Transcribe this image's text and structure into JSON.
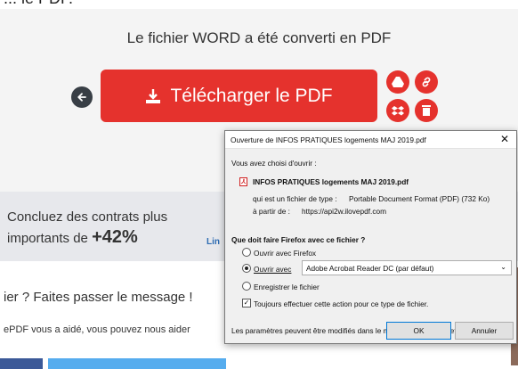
{
  "top_fragment": "... le PDF.",
  "page": {
    "headline": "Le fichier WORD a été converti en PDF",
    "download_label": "Télécharger le PDF",
    "icons": {
      "back": "arrow-left-icon",
      "drive": "google-drive-icon",
      "link": "link-icon",
      "dropbox": "dropbox-icon",
      "delete": "trash-icon"
    }
  },
  "promo": {
    "line1": "Concluez des contrats plus",
    "line2_prefix": "importants de",
    "line2_value": "+42%",
    "link_fragment": "Lin"
  },
  "share": {
    "heading": "ier ? Faites passer le message !",
    "text": "ePDF vous a aidé, vous pouvez nous aider"
  },
  "dialog": {
    "title": "Ouverture de INFOS PRATIQUES logements MAJ 2019.pdf",
    "close": "✕",
    "chose_label": "Vous avez choisi d'ouvrir :",
    "filename": "INFOS PRATIQUES logements MAJ 2019.pdf",
    "type_label": "qui est un fichier de type :",
    "type_value": "Portable Document Format (PDF) (732 Ko)",
    "from_label": "à partir de :",
    "from_value": "https://api2w.ilovepdf.com",
    "question": "Que doit faire Firefox avec ce fichier ?",
    "options": {
      "open_firefox": "Ouvrir avec Firefox",
      "open_with": "Ouvrir avec",
      "save": "Enregistrer le fichier"
    },
    "selected_app": "Adobe Acrobat Reader DC (par défaut)",
    "always_label": "Toujours effectuer cette action pour ce type de fichier.",
    "footer_note": "Les paramètres peuvent être modifiés dans le menu Options de Firefox.",
    "ok": "OK",
    "cancel": "Annuler"
  },
  "colors": {
    "accent": "#e5322d",
    "dark_button": "#383e45",
    "facebook": "#3b5998",
    "twitter": "#55acee"
  }
}
